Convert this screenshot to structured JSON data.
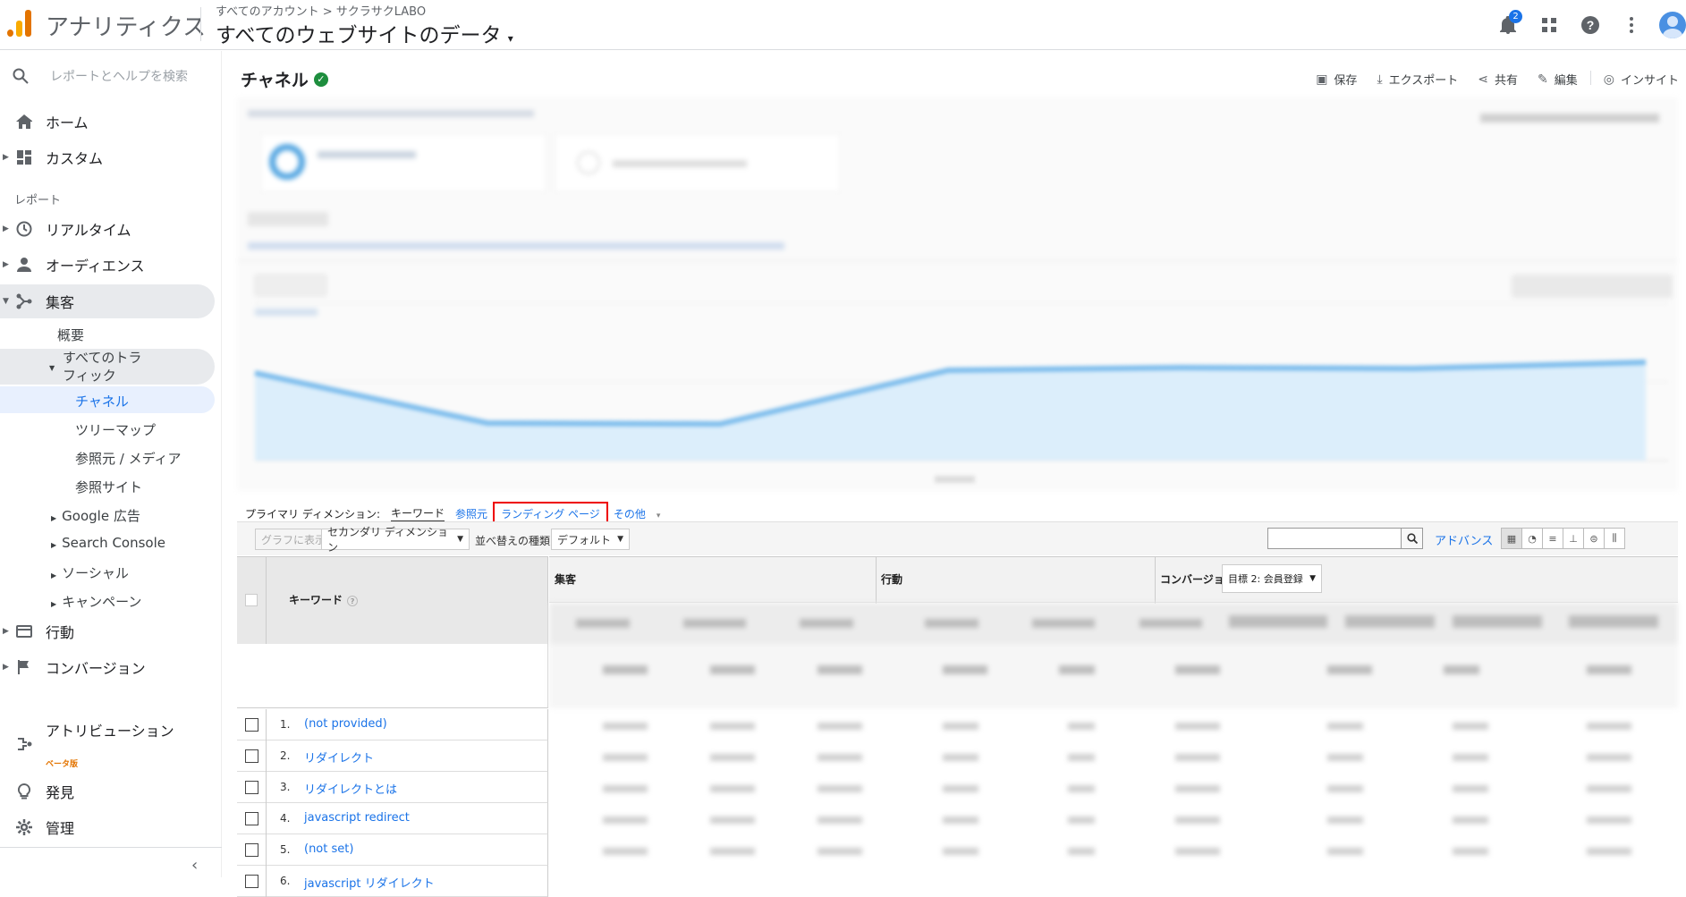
{
  "app": {
    "name": "アナリティクス",
    "breadcrumb": "すべてのアカウント > サクラサクLABO",
    "view": "すべてのウェブサイトのデータ",
    "notification_count": "2"
  },
  "sidebar": {
    "search_placeholder": "レポートとヘルプを検索",
    "home": "ホーム",
    "custom": "カスタム",
    "reports_section": "レポート",
    "realtime": "リアルタイム",
    "audience": "オーディエンス",
    "acquisition": "集客",
    "overview": "概要",
    "all_traffic": "すべてのトラフィック",
    "channels": "チャネル",
    "treemap": "ツリーマップ",
    "source_medium": "参照元 / メディア",
    "referrals": "参照サイト",
    "google_ads": "Google 広告",
    "search_console": "Search Console",
    "social": "ソーシャル",
    "campaigns": "キャンペーン",
    "behavior": "行動",
    "conversions": "コンバージョン",
    "attribution": "アトリビューション",
    "attribution_beta": "ベータ版",
    "discover": "発見",
    "admin": "管理"
  },
  "main": {
    "title": "チャネル",
    "actions": {
      "save": "保存",
      "export": "エクスポート",
      "share": "共有",
      "edit": "編集",
      "insights": "インサイト"
    },
    "primary_dimension_label": "プライマリ ディメンション:",
    "dimensions": {
      "keyword": "キーワード",
      "source": "参照元",
      "landing_page": "ランディング ページ",
      "other": "その他"
    },
    "toolbar": {
      "plot_rows": "グラフに表示",
      "secondary_dimension": "セカンダリ ディメンション",
      "sort_type_label": "並べ替えの種類:",
      "sort_type_value": "デフォルト",
      "advanced": "アドバンス"
    },
    "table": {
      "groups": {
        "acquisition": "集客",
        "behavior": "行動",
        "conversions": "コンバージョン"
      },
      "goal_select": "目標 2: 会員登録",
      "keyword_header": "キーワード",
      "rows": [
        {
          "num": "1.",
          "keyword": "(not provided)"
        },
        {
          "num": "2.",
          "keyword": "リダイレクト"
        },
        {
          "num": "3.",
          "keyword": "リダイレクトとは"
        },
        {
          "num": "4.",
          "keyword": "javascript redirect"
        },
        {
          "num": "5.",
          "keyword": "(not set)"
        },
        {
          "num": "6.",
          "keyword": "javascript リダイレクト"
        }
      ]
    }
  },
  "colors": {
    "accent": "#1a73e8",
    "highlight_box": "#e00000",
    "logo_orange": "#f9ab00",
    "logo_dark": "#e37400"
  }
}
